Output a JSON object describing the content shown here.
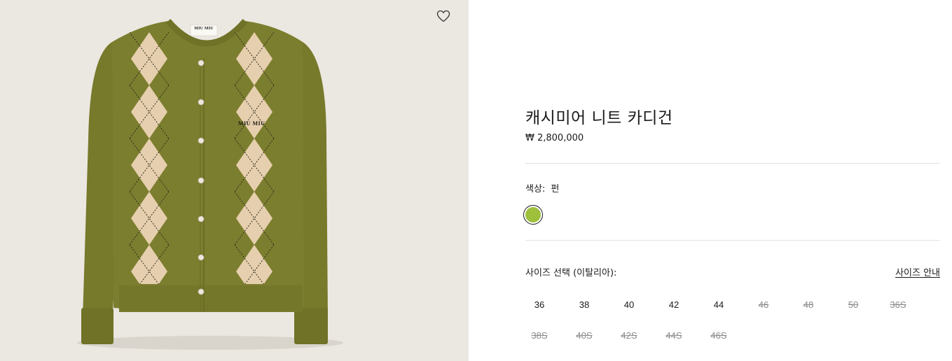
{
  "product": {
    "title": "캐시미어 니트 카디건",
    "price": "₩ 2,800,000",
    "brand_label": "MIU MIU"
  },
  "color": {
    "label": "색상:",
    "selected_name": "펀",
    "swatch_hex": "#9ec03c"
  },
  "size": {
    "label": "사이즈 선택 (이탈리아):",
    "guide_link": "사이즈 안내",
    "options": [
      {
        "label": "36",
        "available": true
      },
      {
        "label": "38",
        "available": true
      },
      {
        "label": "40",
        "available": true
      },
      {
        "label": "42",
        "available": true
      },
      {
        "label": "44",
        "available": true
      },
      {
        "label": "46",
        "available": false
      },
      {
        "label": "48",
        "available": false
      },
      {
        "label": "50",
        "available": false
      },
      {
        "label": "36S",
        "available": false
      },
      {
        "label": "38S",
        "available": false
      },
      {
        "label": "40S",
        "available": false
      },
      {
        "label": "42S",
        "available": false
      },
      {
        "label": "44S",
        "available": false
      },
      {
        "label": "46S",
        "available": false
      }
    ]
  },
  "icons": {
    "wishlist": "heart-outline-icon"
  },
  "colors": {
    "garment": "#7b7e2e",
    "argyle_diamond": "#e8cfae",
    "background": "#ebe7e1"
  }
}
